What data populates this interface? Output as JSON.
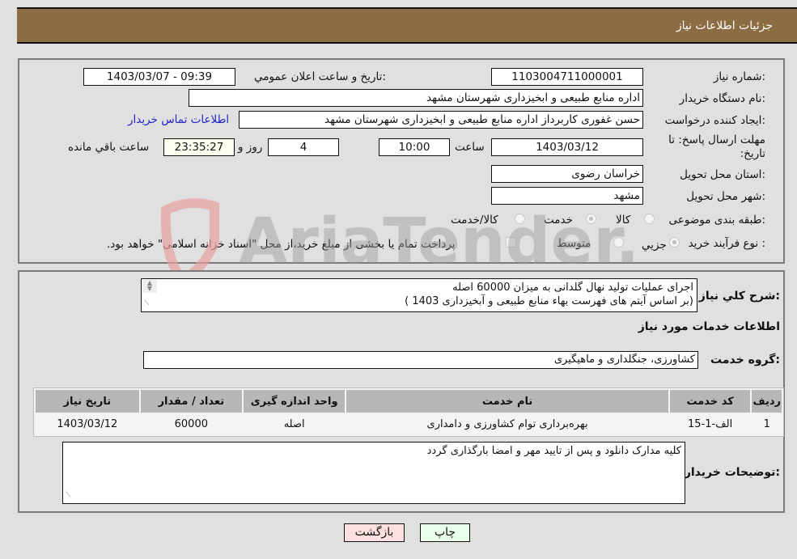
{
  "header": {
    "title": "جزئیات اطلاعات نیاز"
  },
  "details": {
    "need_number_label": "شماره نیاز:",
    "need_number": "1103004711000001",
    "announce_label": "تاریخ و ساعت اعلان عمومي:",
    "announce_value": "1403/03/07 - 09:39",
    "buyer_org_label": "نام دستگاه خریدار:",
    "buyer_org": "اداره منابع طبیعی و ابخیزداری شهرستان مشهد",
    "creator_label": "ایجاد کننده درخواست:",
    "creator": "حسن غفوری کاربرداز اداره منابع طبیعی و ابخیزداری شهرستان مشهد",
    "contact_link": "اطلاعات تماس خریدار",
    "deadline_label": "مهلت ارسال پاسخ: تا تاریخ:",
    "deadline_date": "1403/03/12",
    "time_label": "ساعت",
    "deadline_time": "10:00",
    "days": "4",
    "days_label": "روز و",
    "remaining_time": "23:35:27",
    "remaining_label": "ساعت باقي مانده",
    "province_label": "استان محل تحویل:",
    "province": "خراسان رضوی",
    "city_label": "شهر محل تحویل:",
    "city": "مشهد",
    "category_label": "طبقه بندی موضوعی:",
    "category_options": [
      {
        "label": "کالا",
        "checked": false
      },
      {
        "label": "خدمت",
        "checked": true
      },
      {
        "label": "کالا/خدمت",
        "checked": false
      }
    ],
    "process_label": "نوع فرآیند خرید :",
    "process_options": [
      {
        "label": "جزيي",
        "checked": true
      },
      {
        "label": "متوسط",
        "checked": false
      }
    ],
    "payment_note": "پرداخت تمام یا بخشی از مبلغ خرید،از محل \"اسناد خزانه اسلامی\" خواهد بود."
  },
  "description": {
    "label": "شرح کلي نیاز:",
    "lines": [
      "اجرای عملیات تولید نهال گلدانی به میزان 60000 اصله",
      "(بر اساس آیتم های فهرست بهاء منابع طبیعی و آبخیزداری 1403  )"
    ]
  },
  "services": {
    "section_title": "اطلاعات خدمات مورد نیاز",
    "group_label": "گروه خدمت:",
    "group_value": "کشاورزی، جنگلداری و ماهیگیری",
    "columns": [
      "ردیف",
      "کد خدمت",
      "نام خدمت",
      "واحد اندازه گیری",
      "تعداد / مقدار",
      "تاریخ نیاز"
    ],
    "rows": [
      [
        "1",
        "الف-1-15",
        "بهره‌برداری توام کشاورزی و دامداری",
        "اصله",
        "60000",
        "1403/03/12"
      ]
    ]
  },
  "buyer_notes": {
    "label": "توضیحات خریدار:",
    "text": "کلیه مدارک دانلود و پس از تایید مهر و امضا بارگذاری گردد"
  },
  "buttons": {
    "print": "چاپ",
    "back": "بازگشت"
  },
  "watermark": {
    "text": "AriaTender.neT"
  }
}
